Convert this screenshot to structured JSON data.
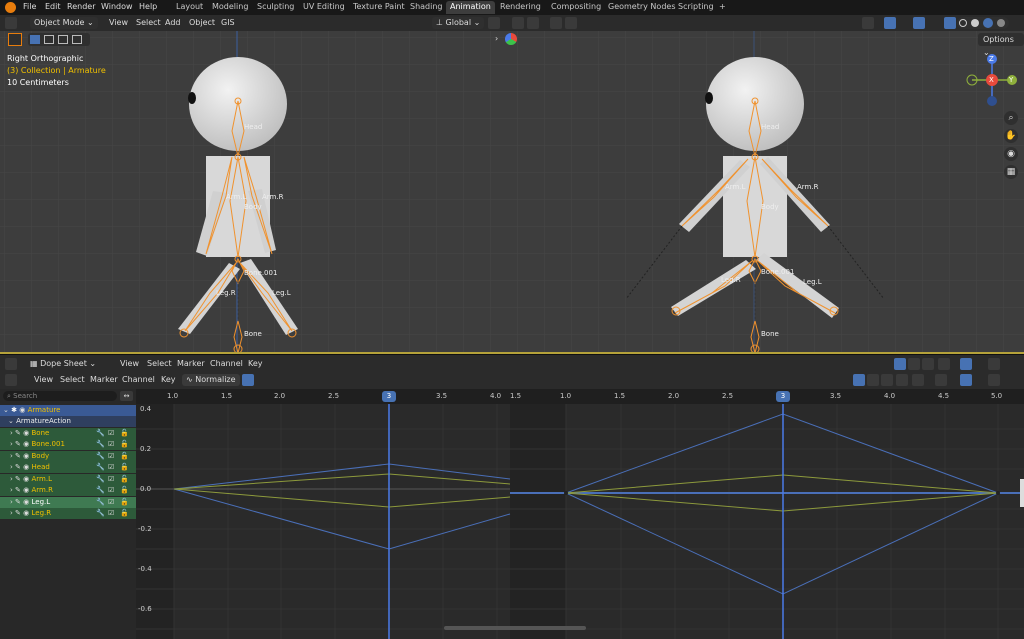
{
  "menu": {
    "items": [
      "File",
      "Edit",
      "Render",
      "Window",
      "Help"
    ]
  },
  "workspaces": {
    "tabs": [
      "Layout",
      "Modeling",
      "Sculpting",
      "UV Editing",
      "Texture Paint",
      "Shading",
      "Animation",
      "Rendering",
      "Compositing",
      "Geometry Nodes",
      "Scripting"
    ],
    "active": "Animation",
    "add_label": "+"
  },
  "viewport_header": {
    "mode": "Object Mode",
    "menus": [
      "View",
      "Select",
      "Add",
      "Object",
      "GIS"
    ],
    "orientation": "Global",
    "options_label": "Options"
  },
  "viewport_info": {
    "view_name": "Right Orthographic",
    "collection": "(3) Collection | Armature",
    "scale": "10 Centimeters"
  },
  "bone_labels": {
    "head": "Head",
    "body": "Body",
    "arm_l": "Arm.L",
    "arm_r": "Arm.R",
    "bone001": "Bone.001",
    "leg_l": "Leg.L",
    "leg_r": "Leg.R",
    "bone": "Bone"
  },
  "gizmo": {
    "z": "Z",
    "y": "Y",
    "x": "X"
  },
  "dopesheet_header": {
    "editor": "Dope Sheet",
    "menus": [
      "View",
      "Select",
      "Marker",
      "Channel",
      "Key"
    ]
  },
  "graph_header": {
    "menus": [
      "View",
      "Select",
      "Marker",
      "Channel",
      "Key"
    ],
    "normalize_label": "Normalize"
  },
  "search": {
    "placeholder": "Search"
  },
  "channels": [
    {
      "label": "Armature",
      "kind": "object"
    },
    {
      "label": "ArmatureAction",
      "kind": "action"
    },
    {
      "label": "Bone",
      "kind": "group"
    },
    {
      "label": "Bone.001",
      "kind": "group"
    },
    {
      "label": "Body",
      "kind": "group"
    },
    {
      "label": "Head",
      "kind": "group"
    },
    {
      "label": "Arm.L",
      "kind": "group"
    },
    {
      "label": "Arm.R",
      "kind": "group"
    },
    {
      "label": "Leg.L",
      "kind": "group-selected"
    },
    {
      "label": "Leg.R",
      "kind": "group"
    }
  ],
  "left_graph": {
    "x_ticks": [
      "1.0",
      "1.5",
      "2.0",
      "2.5",
      "3.0",
      "3.5",
      "4.0"
    ],
    "y_ticks": [
      "0.4",
      "0.2",
      "0.0",
      "-0.2",
      "-0.4",
      "-0.6"
    ],
    "current_frame": "3"
  },
  "right_graph": {
    "x_ticks": [
      "1.5",
      "1.0",
      "1.5",
      "2.0",
      "2.5",
      "3.0",
      "3.5",
      "4.0",
      "4.5",
      "5.0"
    ],
    "current_frame": "3"
  },
  "colors": {
    "accent": "#4772b3",
    "bone_orange": "#f0922e",
    "curve_blue": "#4a6fb8",
    "curve_olive": "#8d9a3c",
    "channel_green": "#2d5a3a",
    "channel_selected": "#3f7a52",
    "channel_text": "#f0c000",
    "split_yellow": "#b5a23a"
  }
}
